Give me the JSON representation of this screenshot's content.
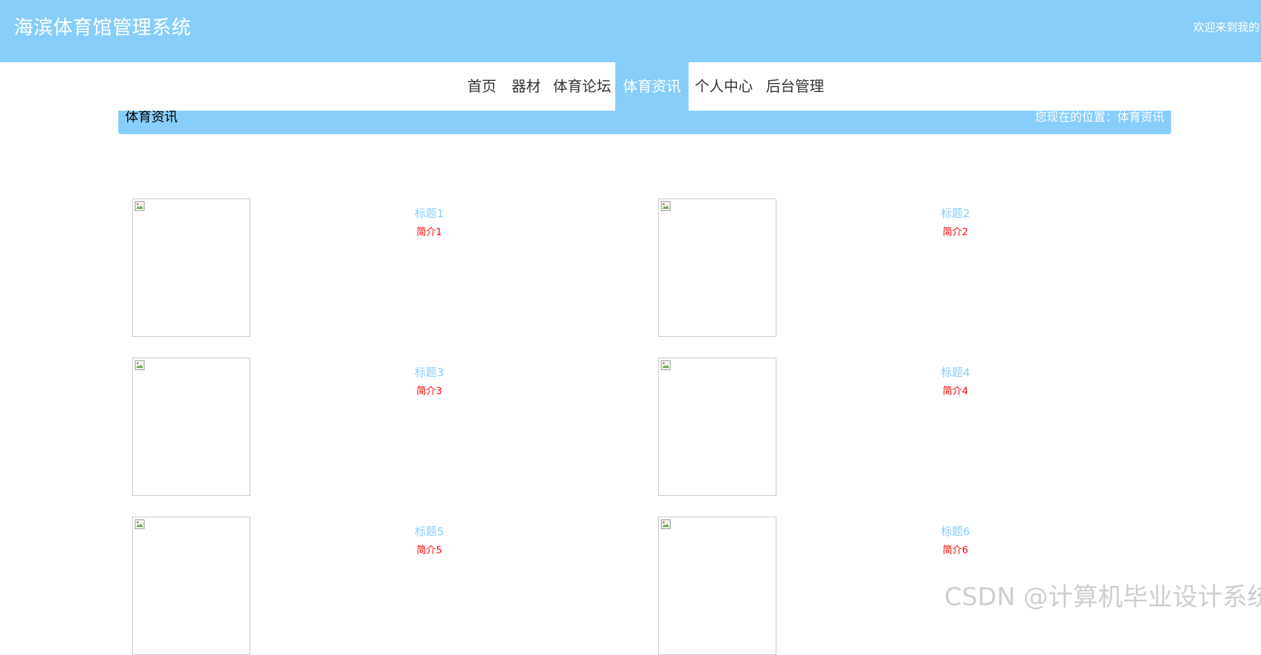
{
  "header": {
    "site_title": "海滨体育馆管理系统",
    "welcome_text": "欢迎来到我的",
    "bg_color": "#87cefa"
  },
  "nav": {
    "items": [
      "首页",
      "器材",
      "体育论坛",
      "体育资讯",
      "个人中心",
      "后台管理"
    ],
    "active_index": 3
  },
  "breadcrumb": {
    "title": "体育资讯",
    "location": "您现在的位置：体育资讯"
  },
  "news": [
    {
      "title": "标题1",
      "desc": "简介1"
    },
    {
      "title": "标题2",
      "desc": "简介2"
    },
    {
      "title": "标题3",
      "desc": "简介3"
    },
    {
      "title": "标题4",
      "desc": "简介4"
    },
    {
      "title": "标题5",
      "desc": "简介5"
    },
    {
      "title": "标题6",
      "desc": "简介6"
    }
  ],
  "icons": {
    "thumbnail": "broken-image-icon"
  },
  "colors": {
    "accent": "#87cefa",
    "title_link": "#87cefa",
    "desc_text": "#ff0000"
  },
  "watermark": "CSDN @计算机毕业设计系统"
}
